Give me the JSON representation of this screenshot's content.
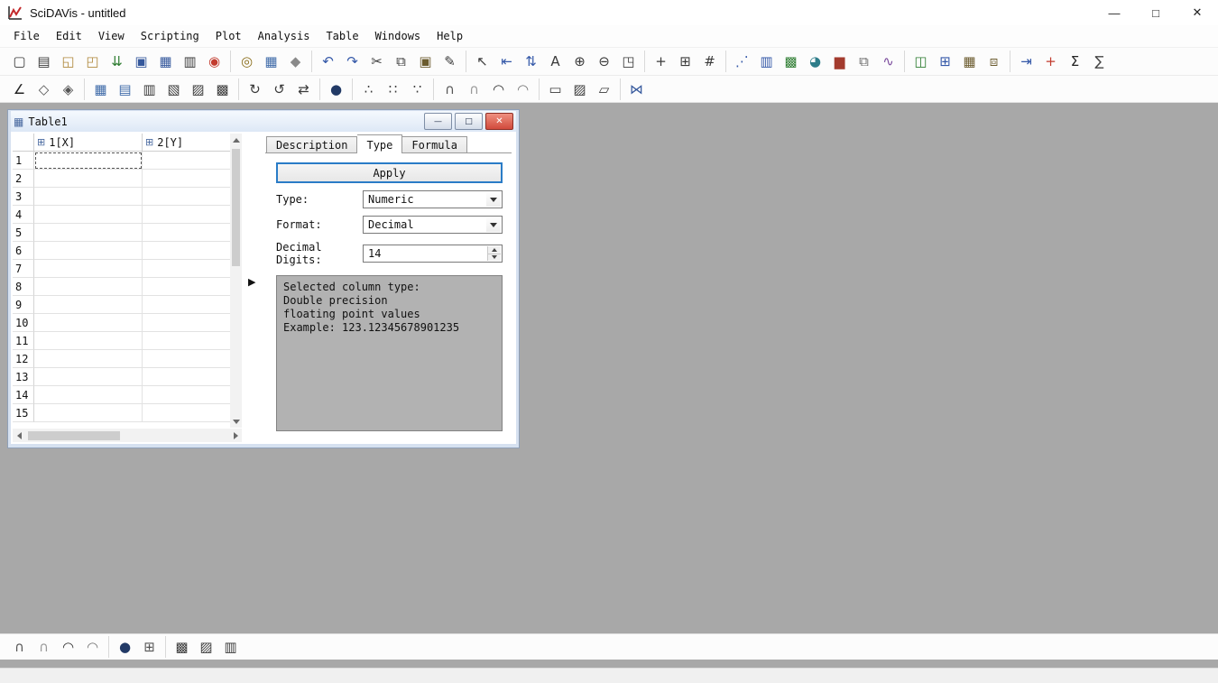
{
  "titlebar": {
    "title": "SciDAVis - untitled",
    "controls": {
      "minimize": "—",
      "maximize": "□",
      "close": "✕"
    }
  },
  "menubar": {
    "items": [
      "File",
      "Edit",
      "View",
      "Scripting",
      "Plot",
      "Analysis",
      "Table",
      "Windows",
      "Help"
    ]
  },
  "toolbars": {
    "main": [
      [
        {
          "name": "new-project",
          "glyph": "▢"
        },
        {
          "name": "new-note",
          "glyph": "▤"
        },
        {
          "name": "open-project",
          "glyph": "◱",
          "color": "#b08a3e"
        },
        {
          "name": "open-template",
          "glyph": "◰",
          "color": "#b08a3e"
        },
        {
          "name": "import-ascii",
          "glyph": "⇊",
          "color": "#2f7d32"
        },
        {
          "name": "save-project",
          "glyph": "▣",
          "color": "#35589c"
        },
        {
          "name": "save-template",
          "glyph": "▦",
          "color": "#35589c"
        },
        {
          "name": "print",
          "glyph": "▥"
        },
        {
          "name": "export-pdf",
          "glyph": "◉",
          "color": "#c23b2e"
        }
      ],
      [
        {
          "name": "find",
          "glyph": "◎",
          "color": "#8a6d1a"
        },
        {
          "name": "preferences",
          "glyph": "▦",
          "color": "#3e6aa8"
        },
        {
          "name": "lock-toolbars",
          "glyph": "◆",
          "color": "#8a8a8a"
        }
      ],
      [
        {
          "name": "undo",
          "glyph": "↶",
          "color": "#3458a8"
        },
        {
          "name": "redo",
          "glyph": "↷",
          "color": "#3458a8"
        },
        {
          "name": "cut",
          "glyph": "✂"
        },
        {
          "name": "copy",
          "glyph": "⧉"
        },
        {
          "name": "paste",
          "glyph": "▣",
          "color": "#6b5b2e"
        },
        {
          "name": "edit-note",
          "glyph": "✎"
        }
      ],
      [
        {
          "name": "pointer",
          "glyph": "↖"
        },
        {
          "name": "select-data-range",
          "glyph": "⇤",
          "color": "#3458a8"
        },
        {
          "name": "select-columns",
          "glyph": "⇅",
          "color": "#3458a8"
        },
        {
          "name": "add-text",
          "glyph": "A"
        },
        {
          "name": "zoom-in",
          "glyph": "⊕"
        },
        {
          "name": "zoom-out",
          "glyph": "⊖"
        },
        {
          "name": "rescale-to-show-all",
          "glyph": "◳"
        }
      ],
      [
        {
          "name": "screen-reader",
          "glyph": "+"
        },
        {
          "name": "data-reader",
          "glyph": "⊞"
        },
        {
          "name": "select-region",
          "glyph": "#"
        }
      ],
      [
        {
          "name": "plot-wizard",
          "glyph": "⋰",
          "color": "#3458a8"
        },
        {
          "name": "plot-vertical-bars",
          "glyph": "▥",
          "color": "#3458a8"
        },
        {
          "name": "add-image",
          "glyph": "▩",
          "color": "#2e7d32"
        },
        {
          "name": "plot-pie",
          "glyph": "◕",
          "color": "#2e7d8a"
        },
        {
          "name": "plot-histogram",
          "glyph": "▆",
          "color": "#a33b2e"
        },
        {
          "name": "duplicate-window",
          "glyph": "⧉",
          "color": "#666666"
        },
        {
          "name": "fit-wizard",
          "glyph": "∿",
          "color": "#7a4a9c"
        }
      ],
      [
        {
          "name": "add-layer",
          "glyph": "◫",
          "color": "#2e7d32"
        },
        {
          "name": "add-inset-layer",
          "glyph": "⊞",
          "color": "#3458a8"
        },
        {
          "name": "layer-grid",
          "glyph": "▦",
          "color": "#6b5b2e"
        },
        {
          "name": "arrange-layers",
          "glyph": "⧈",
          "color": "#6b5b2e"
        }
      ],
      [
        {
          "name": "statistics-on-rows",
          "glyph": "⇥",
          "color": "#3458a8"
        },
        {
          "name": "add-column",
          "glyph": "+",
          "color": "#c23b2e"
        },
        {
          "name": "set-column-values",
          "glyph": "Σ",
          "color": "#222222"
        },
        {
          "name": "statistics-on-columns",
          "glyph": "∑",
          "color": "#444444"
        }
      ]
    ],
    "plot": [
      [
        {
          "name": "plot-line",
          "glyph": "∠",
          "color": "#222222"
        },
        {
          "name": "plot-polygon",
          "glyph": "◇",
          "color": "#555555"
        },
        {
          "name": "plot-filled-polygon",
          "glyph": "◈",
          "color": "#555555"
        }
      ],
      [
        {
          "name": "new-table",
          "glyph": "▦",
          "color": "#3e6aa8"
        },
        {
          "name": "new-matrix",
          "glyph": "▤",
          "color": "#3e6aa8"
        },
        {
          "name": "matrix-transpose",
          "glyph": "▥"
        },
        {
          "name": "matrix-mirror-horizontal",
          "glyph": "▧"
        },
        {
          "name": "matrix-mirror-vertical",
          "glyph": "▨"
        },
        {
          "name": "matrix-invert",
          "glyph": "▩"
        }
      ],
      [
        {
          "name": "rotate-clockwise",
          "glyph": "↻"
        },
        {
          "name": "rotate-counterclockwise",
          "glyph": "↺"
        },
        {
          "name": "swap-axes",
          "glyph": "⇄"
        }
      ],
      [
        {
          "name": "color-drop",
          "glyph": "●",
          "color": "#223a66"
        }
      ],
      [
        {
          "name": "scatter-dots",
          "glyph": "∴"
        },
        {
          "name": "scatter-crosses",
          "glyph": "∷"
        },
        {
          "name": "scatter-cones",
          "glyph": "∵"
        }
      ],
      [
        {
          "name": "plot-3d-wireframe",
          "glyph": "∩",
          "color": "#555555"
        },
        {
          "name": "plot-3d-hidden-line",
          "glyph": "∩",
          "color": "#999999"
        },
        {
          "name": "plot-3d-polygon",
          "glyph": "◠",
          "color": "#333333"
        },
        {
          "name": "plot-3d-wire-surface",
          "glyph": "◠",
          "color": "#777777"
        }
      ],
      [
        {
          "name": "floor-data-projection",
          "glyph": "▭"
        },
        {
          "name": "floor-isolines",
          "glyph": "▨"
        },
        {
          "name": "floor-empty",
          "glyph": "▱"
        }
      ],
      [
        {
          "name": "plot-vectors",
          "glyph": "⋈",
          "color": "#35589c"
        }
      ]
    ],
    "bottom": [
      [
        {
          "name": "surface-wireframe",
          "glyph": "∩",
          "color": "#555555"
        },
        {
          "name": "surface-hidden-line",
          "glyph": "∩",
          "color": "#999999"
        },
        {
          "name": "surface-polygon",
          "glyph": "◠",
          "color": "#333333"
        },
        {
          "name": "surface-wireframe-polygon",
          "glyph": "◠",
          "color": "#777777"
        }
      ],
      [
        {
          "name": "color-map",
          "glyph": "●",
          "color": "#223a66"
        },
        {
          "name": "3d-grid",
          "glyph": "⊞",
          "color": "#555555"
        }
      ],
      [
        {
          "name": "contour-plot",
          "glyph": "▩"
        },
        {
          "name": "density-plot",
          "glyph": "▨"
        },
        {
          "name": "grayscale-plot",
          "glyph": "▥"
        }
      ]
    ]
  },
  "table_window": {
    "title": "Table1",
    "title_icon": "▦",
    "controls": {
      "minimize": "—",
      "restore": "□",
      "close": "✕"
    },
    "column_icon": "⊞",
    "columns": [
      "1[X]",
      "2[Y]"
    ],
    "row_numbers": [
      "1",
      "2",
      "3",
      "4",
      "5",
      "6",
      "7",
      "8",
      "9",
      "10",
      "11",
      "12",
      "13",
      "14",
      "15"
    ],
    "splitter_glyph": "▶",
    "side_panel": {
      "tabs": [
        "Description",
        "Type",
        "Formula"
      ],
      "active_tab": "Type",
      "apply_label": "Apply",
      "fields": [
        {
          "name": "type",
          "label": "Type:",
          "kind": "select",
          "value": "Numeric"
        },
        {
          "name": "format",
          "label": "Format:",
          "kind": "select",
          "value": "Decimal"
        },
        {
          "name": "decimal-digits",
          "label": "Decimal Digits:",
          "kind": "spin",
          "value": "14"
        }
      ],
      "info_lines": [
        "Selected column type:",
        "Double precision",
        "floating point values",
        "Example: 123.12345678901235"
      ]
    }
  },
  "colors": {
    "accent_blue": "#2a7cc7",
    "close_red": "#d14a3c",
    "workspace_gray": "#a8a8a8"
  }
}
